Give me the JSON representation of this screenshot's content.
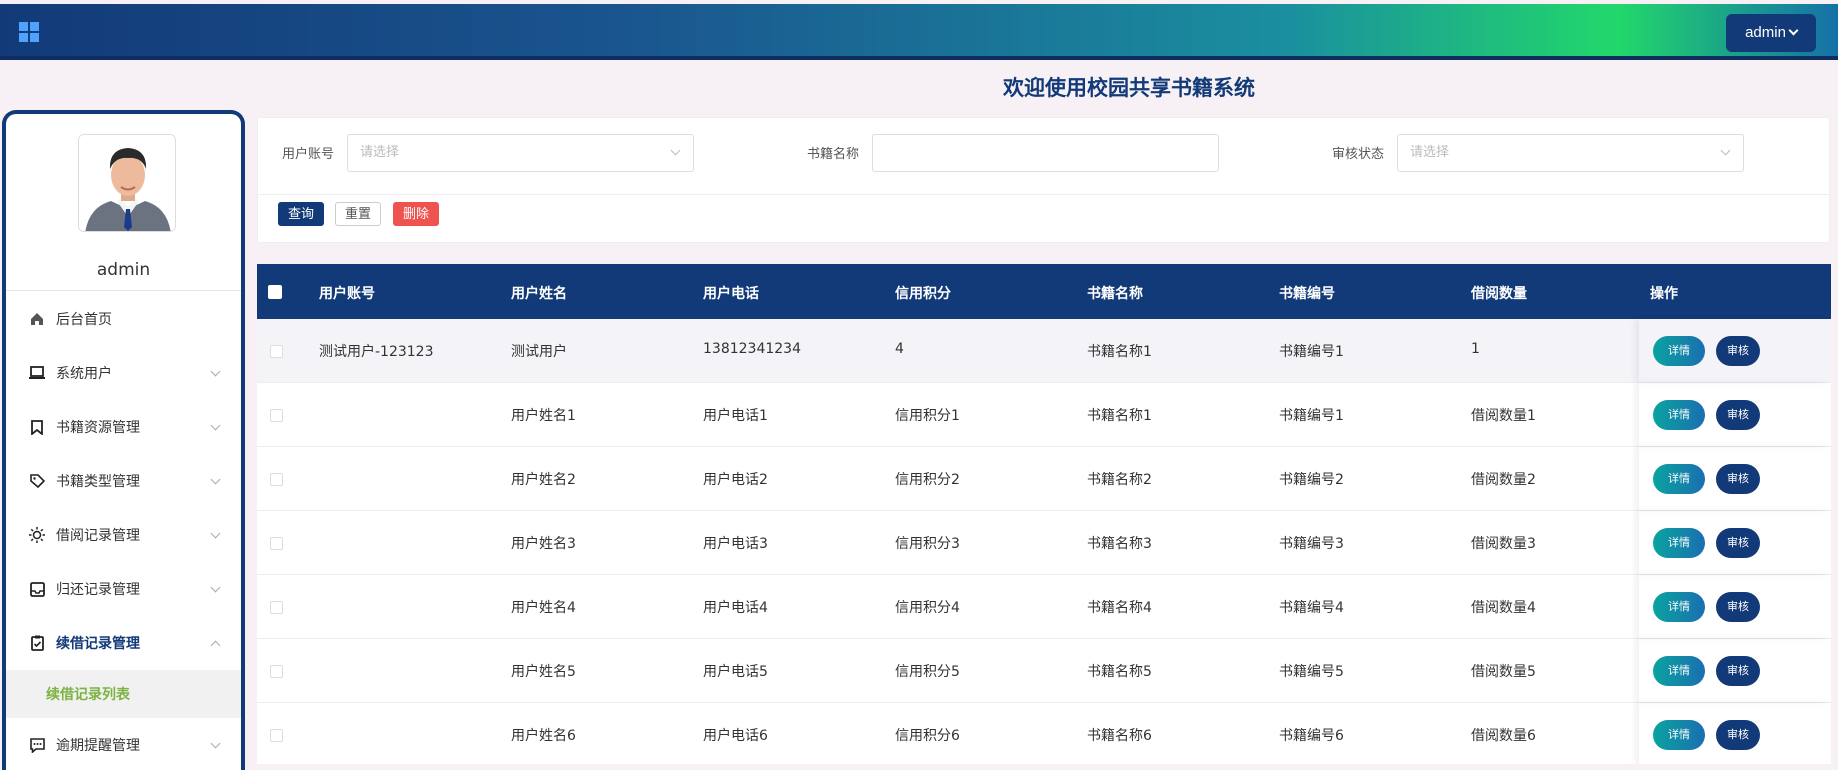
{
  "header": {
    "user_button": "admin"
  },
  "page_title": "欢迎使用校园共享书籍系统",
  "sidebar": {
    "username": "admin",
    "items": [
      {
        "label": "后台首页",
        "icon": "home-icon",
        "expandable": false
      },
      {
        "label": "系统用户",
        "icon": "laptop-icon",
        "expandable": true
      },
      {
        "label": "书籍资源管理",
        "icon": "bookmark-icon",
        "expandable": true
      },
      {
        "label": "书籍类型管理",
        "icon": "tag-icon",
        "expandable": true
      },
      {
        "label": "借阅记录管理",
        "icon": "sun-icon",
        "expandable": true
      },
      {
        "label": "归还记录管理",
        "icon": "inbox-icon",
        "expandable": true
      },
      {
        "label": "续借记录管理",
        "icon": "clipboard-check-icon",
        "expandable": true,
        "active": true
      },
      {
        "label": "逾期提醒管理",
        "icon": "message-icon",
        "expandable": true
      }
    ],
    "subitem": "续借记录列表"
  },
  "filter": {
    "user_account_label": "用户账号",
    "user_account_placeholder": "请选择",
    "book_name_label": "书籍名称",
    "book_name_value": "",
    "review_status_label": "审核状态",
    "review_status_placeholder": "请选择",
    "query_button": "查询",
    "reset_button": "重置",
    "delete_button": "删除"
  },
  "table": {
    "headers": [
      "用户账号",
      "用户姓名",
      "用户电话",
      "信用积分",
      "书籍名称",
      "书籍编号",
      "借阅数量",
      "操作"
    ],
    "detail_button": "详情",
    "audit_button": "审核",
    "rows": [
      [
        "测试用户-123123",
        "测试用户",
        "13812341234",
        "4",
        "书籍名称1",
        "书籍编号1",
        "1"
      ],
      [
        "",
        "用户姓名1",
        "用户电话1",
        "信用积分1",
        "书籍名称1",
        "书籍编号1",
        "借阅数量1"
      ],
      [
        "",
        "用户姓名2",
        "用户电话2",
        "信用积分2",
        "书籍名称2",
        "书籍编号2",
        "借阅数量2"
      ],
      [
        "",
        "用户姓名3",
        "用户电话3",
        "信用积分3",
        "书籍名称3",
        "书籍编号3",
        "借阅数量3"
      ],
      [
        "",
        "用户姓名4",
        "用户电话4",
        "信用积分4",
        "书籍名称4",
        "书籍编号4",
        "借阅数量4"
      ],
      [
        "",
        "用户姓名5",
        "用户电话5",
        "信用积分5",
        "书籍名称5",
        "书籍编号5",
        "借阅数量5"
      ],
      [
        "",
        "用户姓名6",
        "用户电话6",
        "信用积分6",
        "书籍名称6",
        "书籍编号6",
        "借阅数量6"
      ]
    ]
  }
}
